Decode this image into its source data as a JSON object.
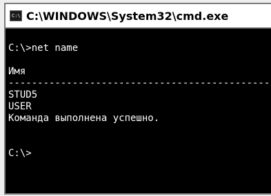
{
  "window": {
    "title": "C:\\WINDOWS\\System32\\cmd.exe",
    "icon": "cmd-icon",
    "icon_text": "C:\\"
  },
  "console": {
    "lines": [
      "C:\\>net name",
      "",
      "Имя",
      "-------------------------------------------------",
      "STUD5",
      "USER",
      "Команда выполнена успешно.",
      "",
      "",
      "C:\\>"
    ]
  },
  "colors": {
    "console_bg": "#000000",
    "console_fg": "#ffffff",
    "titlebar_bg": "#ffffff"
  }
}
